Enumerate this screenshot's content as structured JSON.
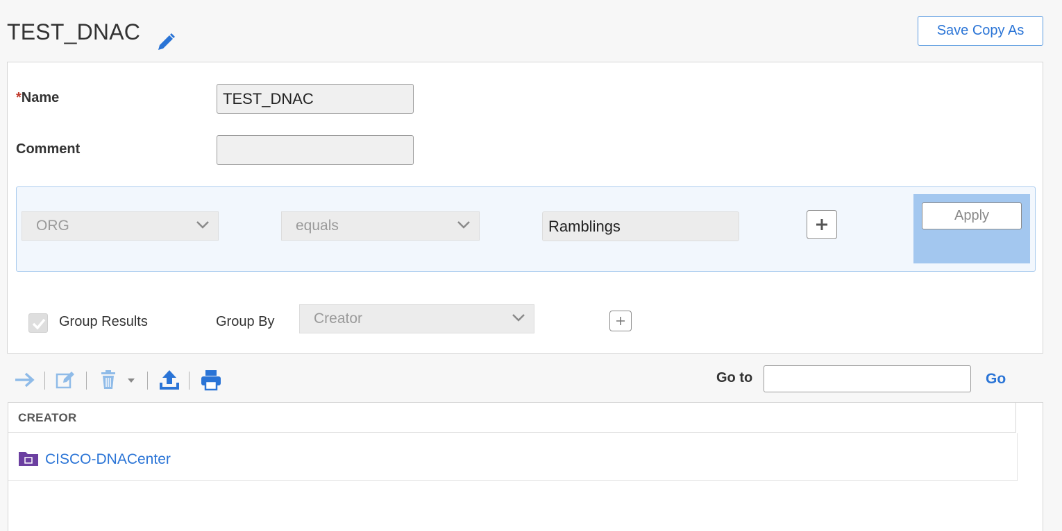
{
  "header": {
    "title": "TEST_DNAC",
    "edit_icon": "pencil-icon",
    "save_copy_label": "Save Copy As"
  },
  "form": {
    "name_required_marker": "*",
    "name_label": "Name",
    "name_value": "TEST_DNAC",
    "comment_label": "Comment",
    "comment_value": ""
  },
  "filter": {
    "field_value": "ORG",
    "operator_value": "equals",
    "criteria_value": "Ramblings",
    "add_icon": "plus-icon",
    "apply_label": "Apply"
  },
  "grouping": {
    "group_results_label": "Group Results",
    "group_results_checked": true,
    "group_by_label": "Group By",
    "group_by_value": "Creator",
    "add_icon": "plus-icon"
  },
  "toolbar": {
    "icons": [
      "arrow-right-icon",
      "edit-icon",
      "trash-icon",
      "caret-down-icon",
      "upload-icon",
      "print-icon"
    ],
    "goto_label": "Go to",
    "goto_value": "",
    "go_label": "Go"
  },
  "table": {
    "columns": [
      "CREATOR"
    ],
    "rows": [
      {
        "icon": "folder-icon",
        "label": "CISCO-DNACenter"
      }
    ]
  },
  "colors": {
    "accent": "#2a74d6",
    "apply_area": "#a3c7ef",
    "filter_bg": "#f2f7fd",
    "folder": "#6b3fa0"
  }
}
